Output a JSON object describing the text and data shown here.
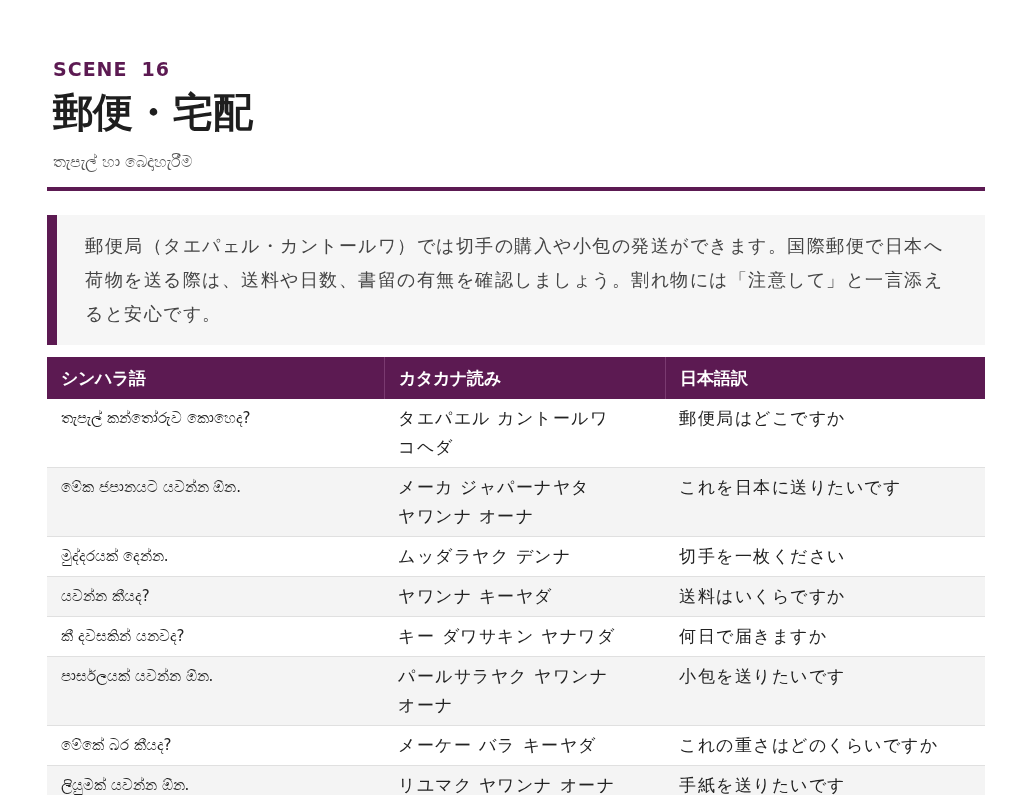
{
  "header": {
    "scene_label": "SCENE",
    "scene_number": "16",
    "title": "郵便・宅配",
    "subtitle": "තැපැල් හා බෙදාහැරීම"
  },
  "intro": "郵便局（タエパェル・カントールワ）では切手の購入や小包の発送ができます。国際郵便で日本へ荷物を送る際は、送料や日数、書留の有無を確認しましょう。割れ物には「注意して」と一言添えると安心です。",
  "table": {
    "columns": [
      "シンハラ語",
      "カタカナ読み",
      "日本語訳"
    ],
    "rows": [
      {
        "sinhala": "තැපැල් කන්තෝරුව කොහෙද?",
        "katakana": [
          "タエパエル カントールワ",
          "コヘダ"
        ],
        "japanese": "郵便局はどこですか"
      },
      {
        "sinhala": "මේක ජපානයට යවන්න ඕන.",
        "katakana": [
          "メーカ ジャパーナヤタ",
          "ヤワンナ オーナ"
        ],
        "japanese": "これを日本に送りたいです"
      },
      {
        "sinhala": "මුද්දරයක් දෙන්න.",
        "katakana": [
          "ムッダラヤク デンナ"
        ],
        "japanese": "切手を一枚ください"
      },
      {
        "sinhala": "යවන්න කීයද?",
        "katakana": [
          "ヤワンナ キーヤダ"
        ],
        "japanese": "送料はいくらですか"
      },
      {
        "sinhala": "කී දවසකින් යනවද?",
        "katakana": [
          "キー ダワサキン ヤナワダ"
        ],
        "japanese": "何日で届きますか"
      },
      {
        "sinhala": "පාර්සලයක් යවන්න ඕන.",
        "katakana": [
          "パールサラヤク ヤワンナ",
          "オーナ"
        ],
        "japanese": "小包を送りたいです"
      },
      {
        "sinhala": "මේකේ බර කීයද?",
        "katakana": [
          "メーケー バラ キーヤダ"
        ],
        "japanese": "これの重さはどのくらいですか"
      },
      {
        "sinhala": "ලියුමක් යවන්න ඕන.",
        "katakana": [
          "リユマク ヤワンナ オーナ"
        ],
        "japanese": "手紙を送りたいです"
      }
    ]
  }
}
